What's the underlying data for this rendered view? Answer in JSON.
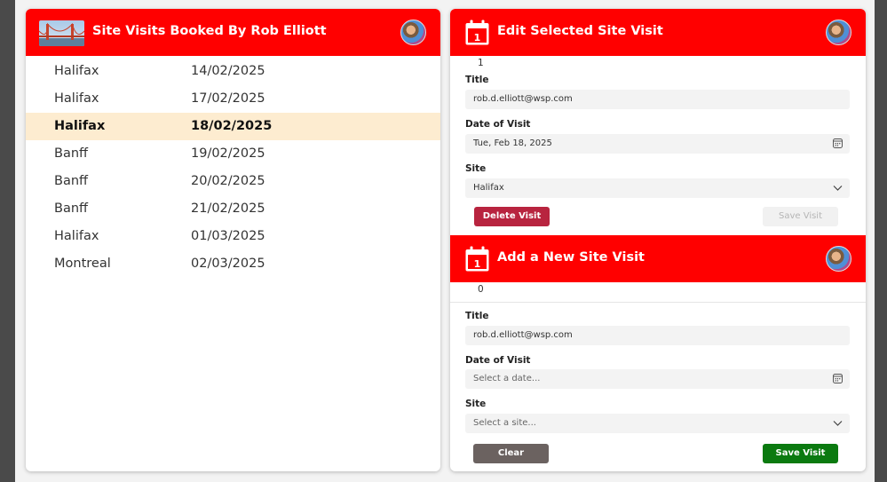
{
  "left_panel": {
    "title": "Site Visits Booked By Rob Elliott",
    "visits": [
      {
        "site": "Halifax",
        "date": "14/02/2025",
        "selected": false
      },
      {
        "site": "Halifax",
        "date": "17/02/2025",
        "selected": false
      },
      {
        "site": "Halifax",
        "date": "18/02/2025",
        "selected": true
      },
      {
        "site": "Banff",
        "date": "19/02/2025",
        "selected": false
      },
      {
        "site": "Banff",
        "date": "20/02/2025",
        "selected": false
      },
      {
        "site": "Banff",
        "date": "21/02/2025",
        "selected": false
      },
      {
        "site": "Halifax",
        "date": "01/03/2025",
        "selected": false
      },
      {
        "site": "Montreal",
        "date": "02/03/2025",
        "selected": false
      }
    ]
  },
  "edit_panel": {
    "title": "Edit Selected Site Visit",
    "id": "1",
    "title_label": "Title",
    "title_value": "rob.d.elliott@wsp.com",
    "date_label": "Date of Visit",
    "date_value": "Tue, Feb 18, 2025",
    "site_label": "Site",
    "site_value": "Halifax",
    "delete_label": "Delete Visit",
    "save_label": "Save Visit"
  },
  "add_panel": {
    "title": "Add a New Site Visit",
    "id": "0",
    "title_label": "Title",
    "title_value": "rob.d.elliott@wsp.com",
    "date_label": "Date of Visit",
    "date_placeholder": "Select a date...",
    "site_label": "Site",
    "site_placeholder": "Select a site...",
    "clear_label": "Clear",
    "save_label": "Save Visit"
  },
  "colors": {
    "header_red": "#ff0000",
    "selected_row": "#fdecd0",
    "delete_button": "#b8243f",
    "save_button": "#0b7a10",
    "clear_button": "#6b6260"
  },
  "icons": {
    "header_image": "golden-gate-bridge-image",
    "calendar": "calendar-icon",
    "avatar": "user-avatar",
    "date_picker": "calendar-small-icon",
    "dropdown": "chevron-down-icon"
  }
}
